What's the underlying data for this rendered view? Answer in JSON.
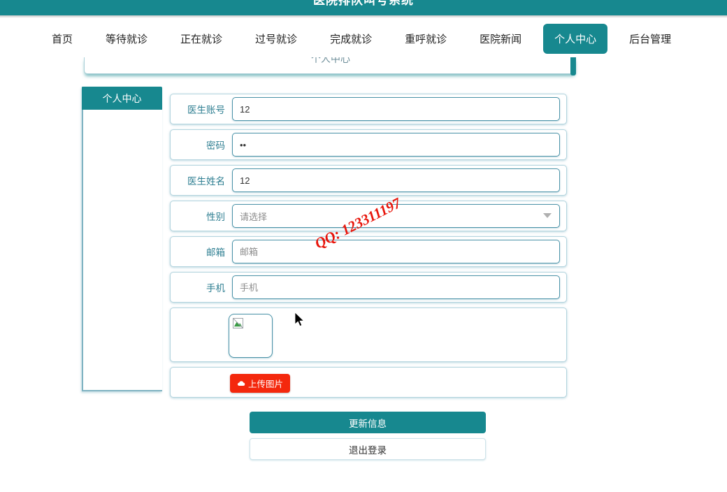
{
  "window": {
    "title": "医院排队叫号系统"
  },
  "nav": {
    "items": [
      {
        "label": "首页",
        "active": false
      },
      {
        "label": "等待就诊",
        "active": false
      },
      {
        "label": "正在就诊",
        "active": false
      },
      {
        "label": "过号就诊",
        "active": false
      },
      {
        "label": "完成就诊",
        "active": false
      },
      {
        "label": "重呼就诊",
        "active": false
      },
      {
        "label": "医院新闻",
        "active": false
      },
      {
        "label": "个人中心",
        "active": true
      },
      {
        "label": "后台管理",
        "active": false
      }
    ]
  },
  "panel": {
    "header_title": "个人中心"
  },
  "sidebar": {
    "tab_label": "个人中心"
  },
  "form": {
    "fields": [
      {
        "label": "医生账号",
        "value": "12",
        "placeholder": "",
        "type": "text"
      },
      {
        "label": "密码",
        "value": "••",
        "placeholder": "",
        "type": "password"
      },
      {
        "label": "医生姓名",
        "value": "12",
        "placeholder": "",
        "type": "text"
      },
      {
        "label": "性别",
        "value": "请选择",
        "placeholder": "请选择",
        "type": "select"
      },
      {
        "label": "邮箱",
        "value": "",
        "placeholder": "邮箱",
        "type": "text"
      },
      {
        "label": "手机",
        "value": "",
        "placeholder": "手机",
        "type": "text"
      }
    ],
    "upload_label": "上传图片",
    "avatar_alt": "broken-image"
  },
  "actions": {
    "update_label": "更新信息",
    "logout_label": "退出登录"
  },
  "watermark": {
    "text": "QQ: 123311197"
  },
  "colors": {
    "brand_teal": "#17888f",
    "label_teal": "#2f7f92",
    "upload_red": "#f4280d",
    "border_blue": "#4b93a8",
    "watermark_red": "#e8140a"
  }
}
